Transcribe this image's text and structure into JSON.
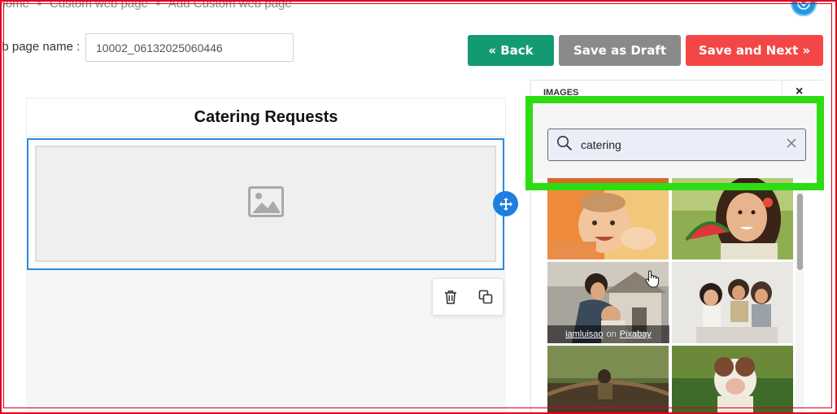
{
  "breadcrumb": {
    "items": [
      "Home",
      "Custom web page",
      "Add Custom web page"
    ]
  },
  "form": {
    "name_label": "eb page name :",
    "name_value": "10002_06132025060446"
  },
  "buttons": {
    "back": "« Back",
    "save_draft": "Save as Draft",
    "save_next": "Save and Next »"
  },
  "canvas": {
    "title": "Catering Requests"
  },
  "panel": {
    "header": "IMAGES",
    "close": "×",
    "search_value": "catering",
    "credit_author": "iamluisao",
    "credit_on": "on",
    "credit_source": "Pixabay"
  },
  "colors": {
    "back_button": "#139a72",
    "draft_button": "#8a8a8a",
    "next_button": "#f34747",
    "selection_blue": "#2a8be0",
    "highlight_green": "#2ddc12",
    "frame_red": "#e0001b"
  },
  "icons": {
    "search": "search-icon",
    "clear": "clear-icon",
    "move": "move-icon",
    "trash": "trash-icon",
    "duplicate": "duplicate-icon",
    "image_placeholder": "image-icon",
    "avatar": "avatar-icon",
    "cursor": "hand-cursor-icon"
  }
}
